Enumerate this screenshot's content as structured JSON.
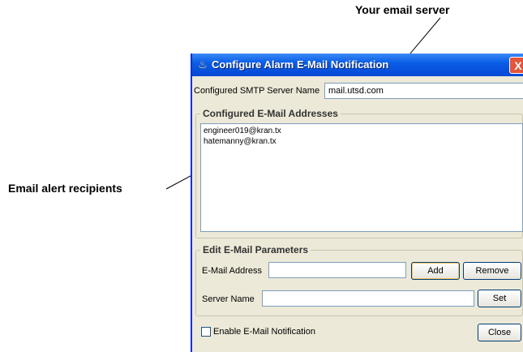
{
  "callouts": {
    "server": "Your email server",
    "recipients": "Email alert recipients"
  },
  "window": {
    "title": "Configure Alarm E-Mail Notification",
    "close_label": "X"
  },
  "smtp": {
    "label": "Configured SMTP Server Name",
    "value": "mail.utsd.com"
  },
  "addresses": {
    "group_title": "Configured E-Mail Addresses",
    "items": [
      "engineer019@kran.tx",
      "hatemanny@kran.tx"
    ]
  },
  "edit": {
    "group_title": "Edit E-Mail Parameters",
    "email_label": "E-Mail Address",
    "email_value": "",
    "add_label": "Add",
    "remove_label": "Remove",
    "server_label": "Server Name",
    "server_value": "",
    "set_label": "Set"
  },
  "footer": {
    "enable_label": "Enable E-Mail Notification",
    "enable_checked": false,
    "close_label": "Close"
  },
  "colors": {
    "titlebar": "#0a5ee6",
    "window_bg": "#ece9d8",
    "close_button": "#e4553b"
  }
}
